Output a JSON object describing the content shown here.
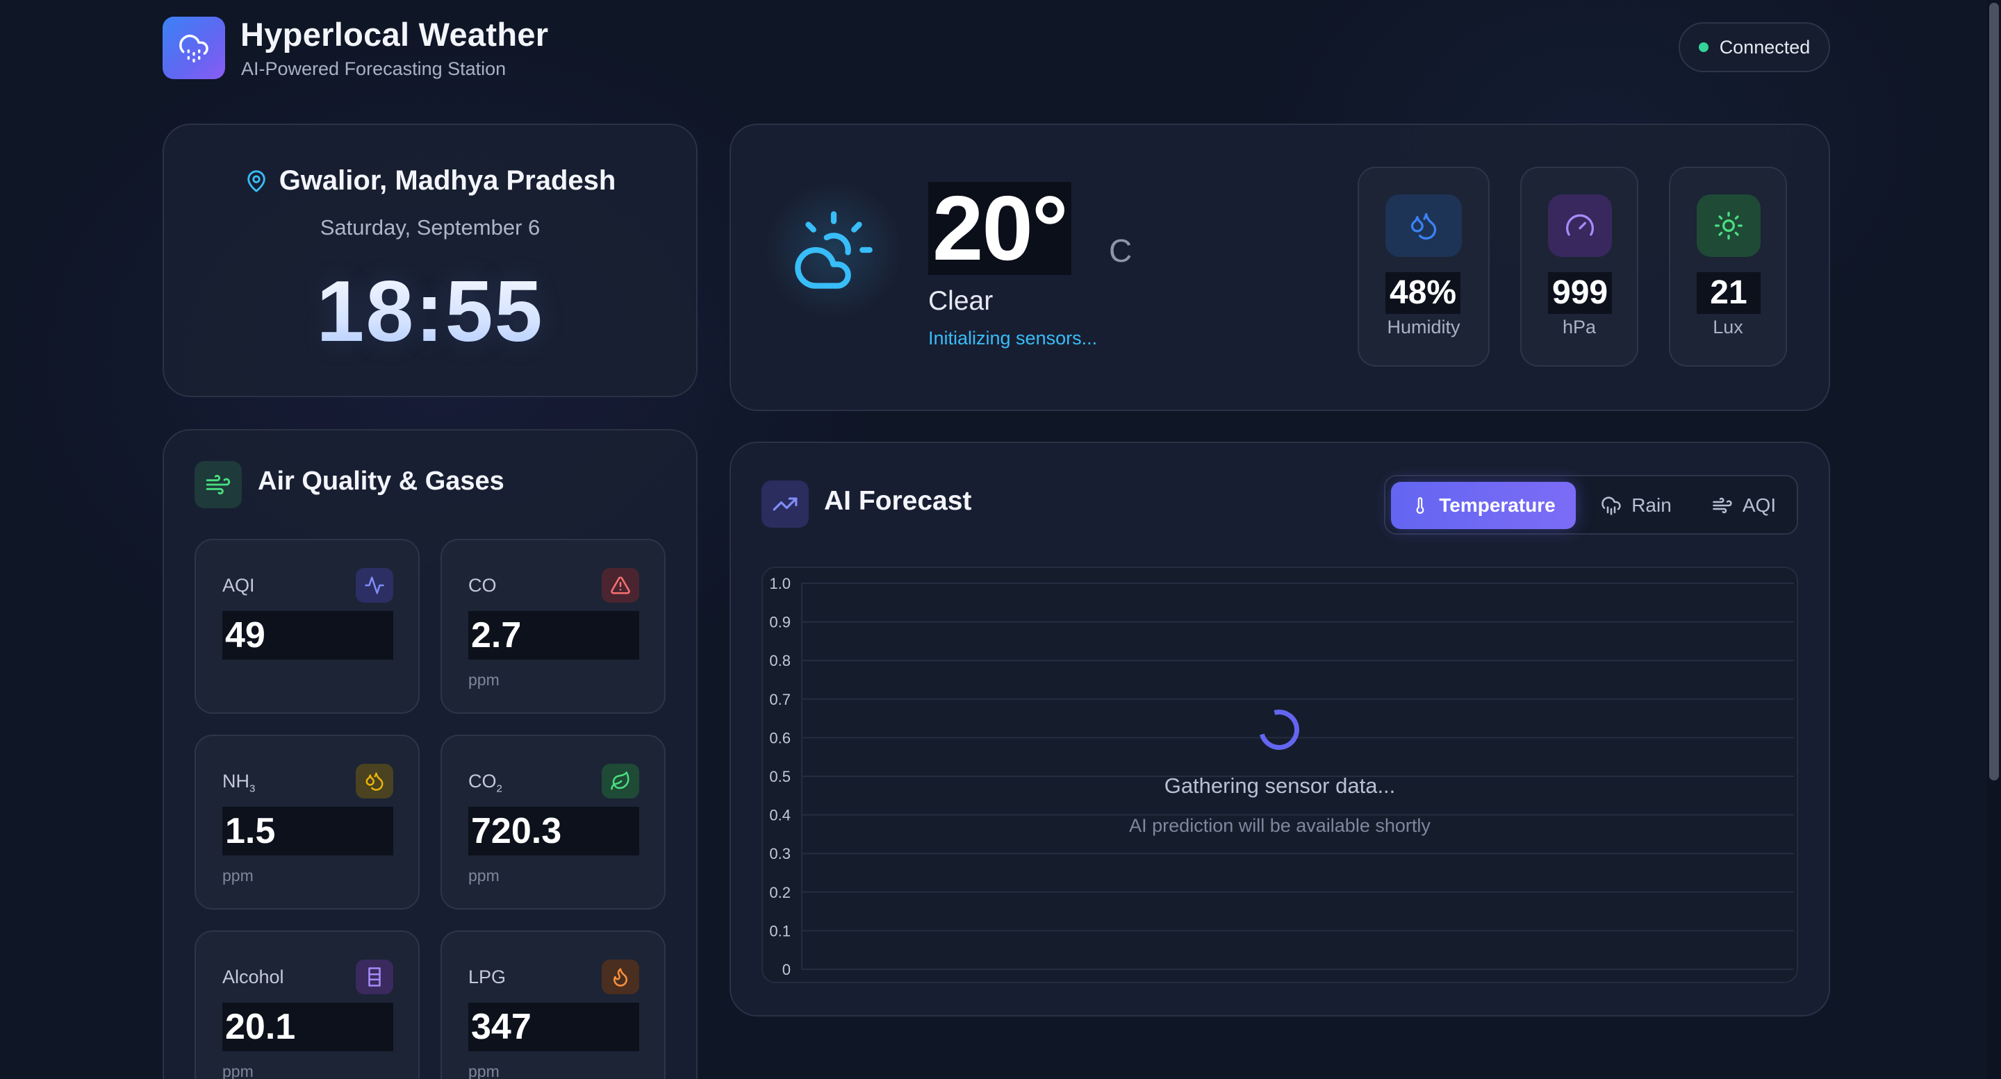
{
  "header": {
    "title": "Hyperlocal Weather",
    "subtitle": "AI-Powered Forecasting Station",
    "logo_icon": "cloud-rain-icon",
    "status": "Connected",
    "status_color": "#34d399"
  },
  "location": {
    "name": "Gwalior, Madhya Pradesh",
    "date": "Saturday, September 6",
    "time": "18:55"
  },
  "current": {
    "temperature": "20°",
    "unit": "C",
    "condition": "Clear",
    "status_text": "Initializing sensors...",
    "stats": [
      {
        "value": "48%",
        "label": "Humidity",
        "icon": "droplets-icon",
        "color": "#3b82f6"
      },
      {
        "value": "999",
        "label": "hPa",
        "icon": "gauge-icon",
        "color": "#8b5cf6"
      },
      {
        "value": "21",
        "label": "Lux",
        "icon": "sun-icon",
        "color": "#22c55e"
      }
    ]
  },
  "air_quality": {
    "title": "Air Quality & Gases",
    "items": [
      {
        "name": "AQI",
        "value": "49",
        "unit": "",
        "icon": "activity-icon",
        "color": "#818cf8"
      },
      {
        "name": "CO",
        "value": "2.7",
        "unit": "ppm",
        "icon": "alert-triangle-icon",
        "color": "#f87171"
      },
      {
        "name": "NH",
        "sub": "3",
        "value": "1.5",
        "unit": "ppm",
        "icon": "droplet-flame-icon",
        "color": "#eab308"
      },
      {
        "name": "CO",
        "sub": "2",
        "value": "720.3",
        "unit": "ppm",
        "icon": "leaf-icon",
        "color": "#4ade80"
      },
      {
        "name": "Alcohol",
        "value": "20.1",
        "unit": "ppm",
        "icon": "glass-icon",
        "color": "#a78bfa"
      },
      {
        "name": "LPG",
        "value": "347",
        "unit": "ppm",
        "icon": "flame-icon",
        "color": "#fb923c"
      }
    ]
  },
  "forecast": {
    "title": "AI Forecast",
    "tabs": [
      {
        "label": "Temperature",
        "icon": "thermometer-icon",
        "active": true
      },
      {
        "label": "Rain",
        "icon": "cloud-rain-icon",
        "active": false
      },
      {
        "label": "AQI",
        "icon": "wind-icon",
        "active": false
      }
    ],
    "loading_title": "Gathering sensor data...",
    "loading_subtitle": "AI prediction will be available shortly"
  },
  "chart_data": {
    "type": "line",
    "title": "",
    "xlabel": "",
    "ylabel": "",
    "ylim": [
      0,
      1
    ],
    "y_ticks": [
      "0",
      "0.1",
      "0.2",
      "0.3",
      "0.4",
      "0.5",
      "0.6",
      "0.7",
      "0.8",
      "0.9",
      "1.0"
    ],
    "grid": true,
    "series": []
  }
}
